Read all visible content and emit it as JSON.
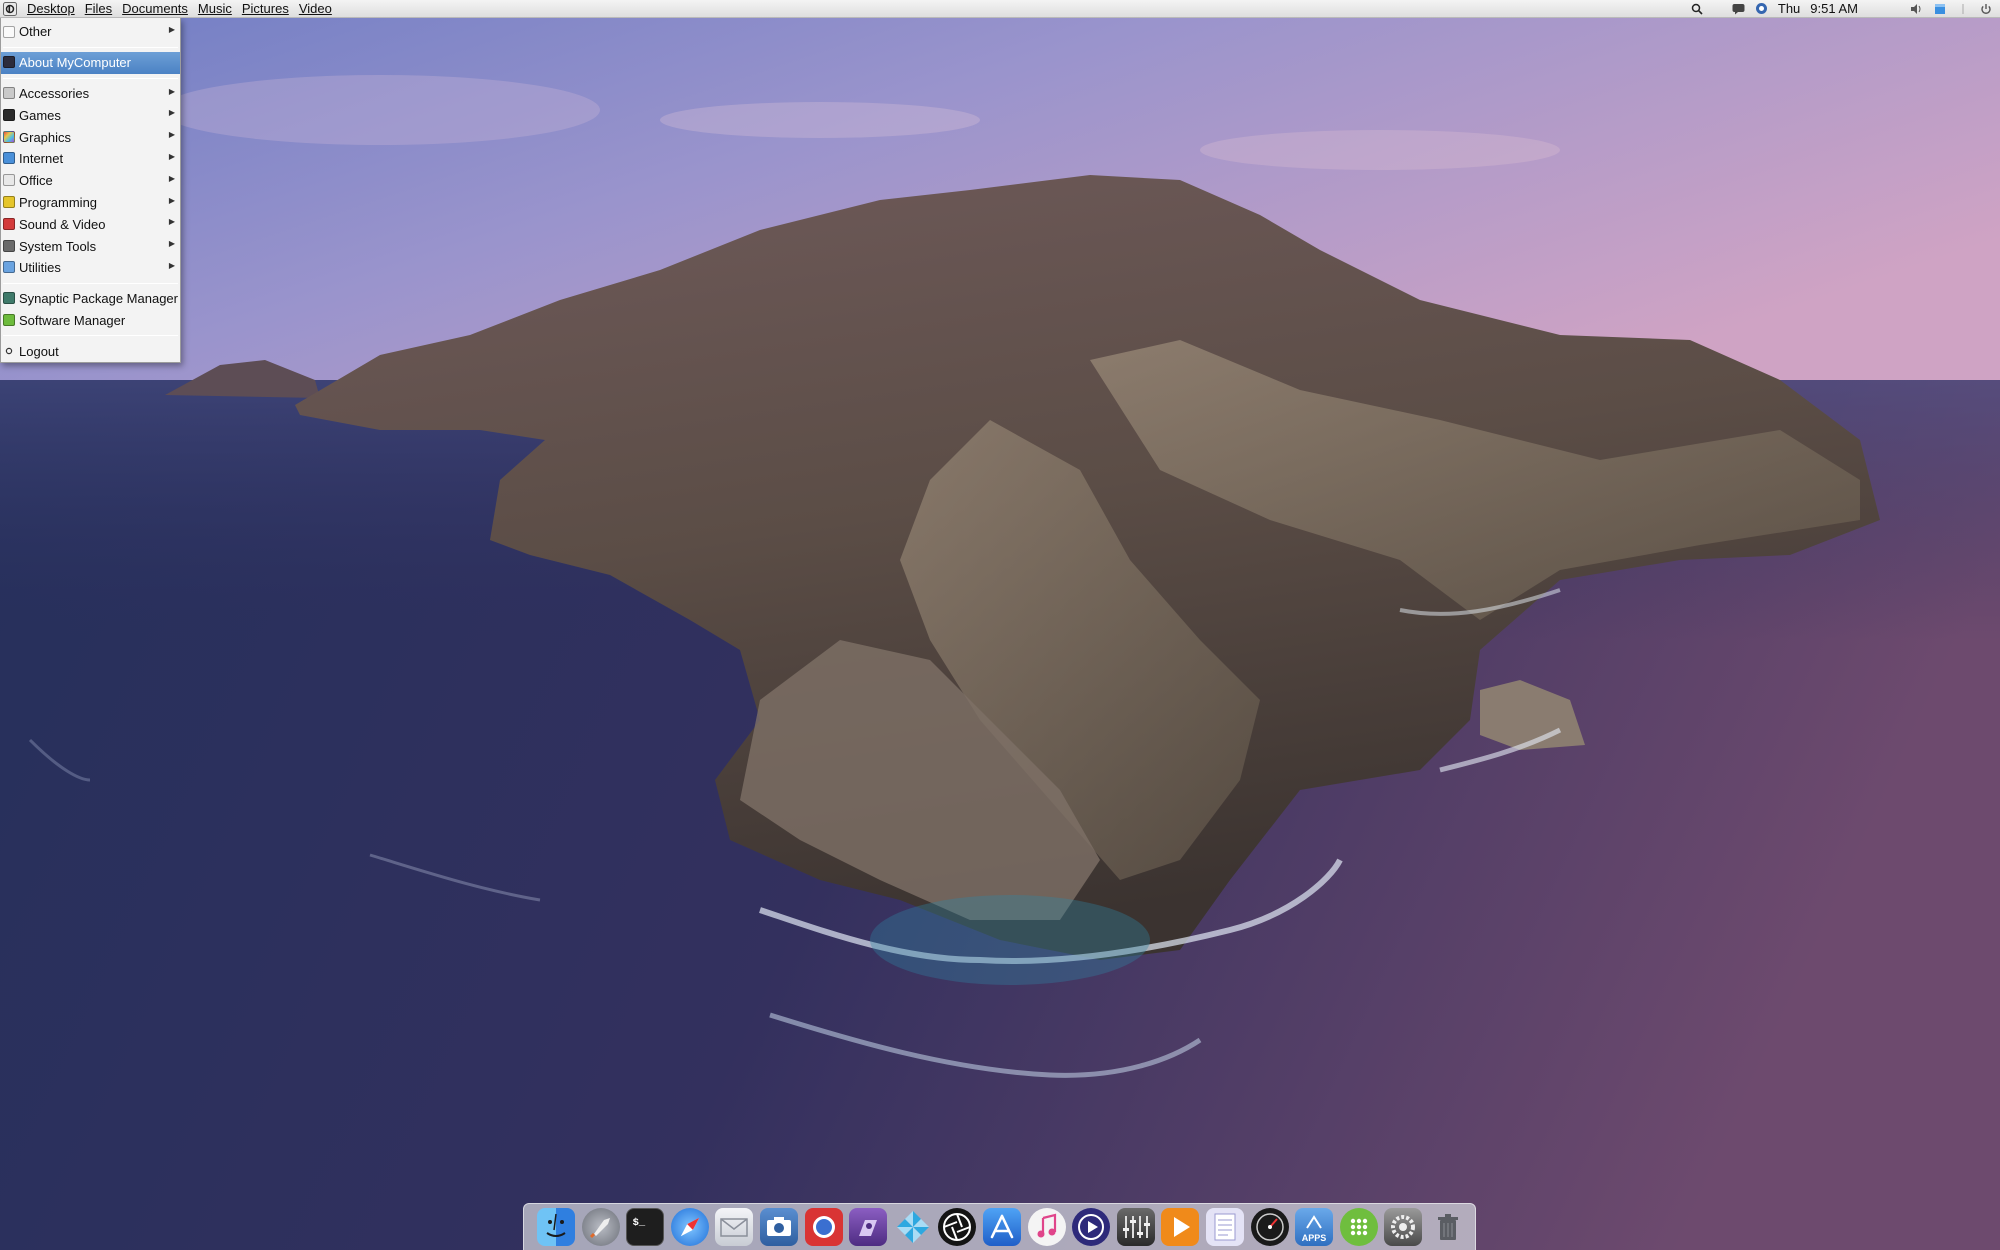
{
  "menubar": {
    "menus": [
      "Desktop",
      "Files",
      "Documents",
      "Music",
      "Pictures",
      "Video"
    ],
    "clock_day": "Thu",
    "clock_time": "9:51 AM",
    "tray_icons": [
      "search-icon",
      "chat-icon",
      "network-icon",
      "volume-icon",
      "battery-icon",
      "power-icon"
    ]
  },
  "app_menu": {
    "top_item": {
      "label": "Other",
      "icon": "document-icon"
    },
    "about": {
      "label": "About MyComputer",
      "icon": "computer-icon"
    },
    "categories": [
      {
        "label": "Accessories",
        "icon": "accessories-icon",
        "color": "#c9c9c9"
      },
      {
        "label": "Games",
        "icon": "games-icon",
        "color": "#2b2b2b"
      },
      {
        "label": "Graphics",
        "icon": "graphics-icon",
        "color": "#d04aa0"
      },
      {
        "label": "Internet",
        "icon": "internet-icon",
        "color": "#4a90d9"
      },
      {
        "label": "Office",
        "icon": "office-icon",
        "color": "#e8e8e8"
      },
      {
        "label": "Programming",
        "icon": "programming-icon",
        "color": "#e5c52b"
      },
      {
        "label": "Sound & Video",
        "icon": "sound-video-icon",
        "color": "#d33b3b"
      },
      {
        "label": "System Tools",
        "icon": "system-tools-icon",
        "color": "#6a6a6a"
      },
      {
        "label": "Utilities",
        "icon": "utilities-icon",
        "color": "#6aa3e0"
      }
    ],
    "packages": [
      {
        "label": "Synaptic Package Manager",
        "icon": "synaptic-icon",
        "color": "#3f7a6a"
      },
      {
        "label": "Software Manager",
        "icon": "software-manager-icon",
        "color": "#6dbb3c"
      }
    ],
    "logout": {
      "label": "Logout",
      "icon": "logout-icon"
    }
  },
  "dock": {
    "apps": [
      {
        "name": "finder-icon",
        "color": "#3a8ee6"
      },
      {
        "name": "launchpad-rocket-icon",
        "color": "#8a8f99"
      },
      {
        "name": "terminal-icon",
        "color": "#1e1e1e"
      },
      {
        "name": "safari-compass-icon",
        "color": "#2f8ff0"
      },
      {
        "name": "mail-icon",
        "color": "#d9dce2"
      },
      {
        "name": "screenshot-camera-icon",
        "color": "#3f6fb0"
      },
      {
        "name": "screen-recorder-icon",
        "color": "#d93434"
      },
      {
        "name": "photo-editor-icon",
        "color": "#6a3fa0"
      },
      {
        "name": "pinwheel-icon",
        "color": "#2da8e0"
      },
      {
        "name": "aperture-icon",
        "color": "#141414"
      },
      {
        "name": "app-store-icon",
        "color": "#2a74d8"
      },
      {
        "name": "music-icon",
        "color": "#f2f2f2"
      },
      {
        "name": "media-player-icon",
        "color": "#2e2a7a"
      },
      {
        "name": "audio-mixer-icon",
        "color": "#4a4a4a"
      },
      {
        "name": "vlc-play-icon",
        "color": "#f08a1a"
      },
      {
        "name": "notes-icon",
        "color": "#dcdcf2"
      },
      {
        "name": "dashboard-gauge-icon",
        "color": "#1a1a1a"
      },
      {
        "name": "apps-folder-icon",
        "color": "#3a78c8"
      },
      {
        "name": "calculator-grid-icon",
        "color": "#6fbe3e"
      },
      {
        "name": "system-preferences-icon",
        "color": "#6b6b6b"
      },
      {
        "name": "trash-icon",
        "color": "#5a5d63"
      }
    ],
    "apps_folder_label": "APPS"
  }
}
